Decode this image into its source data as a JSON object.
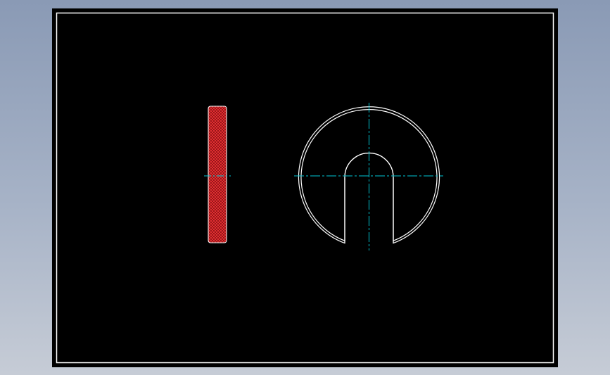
{
  "viewport": {
    "background_top": "#8a9ab5",
    "background_bottom": "#c6ccd6"
  },
  "sheet": {
    "background": "#000000",
    "border_color": "#ffffff"
  },
  "colors": {
    "outline": "#ffffff",
    "centerline": "#00c8d6",
    "hatch_fill": "#8a0f14",
    "hatch_lines": "#ff3b3b"
  },
  "views": [
    {
      "name": "section-view",
      "kind": "hatched-section"
    },
    {
      "name": "front-view",
      "kind": "slotted-washer"
    }
  ]
}
